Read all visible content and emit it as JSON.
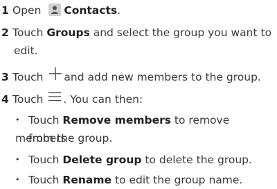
{
  "steps": {
    "s1": {
      "num": "1",
      "pre": "Open ",
      "bold": "Contacts",
      "post": "."
    },
    "s2": {
      "num": "2",
      "pre": "Touch ",
      "bold": "Groups",
      "post": " and select the group you want to",
      "post2": "edit."
    },
    "s3": {
      "num": "3",
      "pre": "Touch ",
      "post": "and add new members to the group."
    },
    "s4": {
      "num": "4",
      "pre": "Touch ",
      "post": ". You can then:"
    }
  },
  "bullets": [
    {
      "pre": "Touch ",
      "bold": "Remove members",
      "post": " to remove members",
      "post2": "from the group."
    },
    {
      "pre": "Touch ",
      "bold": "Delete group",
      "post": " to delete the group."
    },
    {
      "pre": "Touch ",
      "bold": "Rename",
      "post": " to edit the group name."
    }
  ],
  "bullet_glyph": "•",
  "icons": [
    "contacts-icon",
    "plus-icon",
    "menu-icon"
  ]
}
